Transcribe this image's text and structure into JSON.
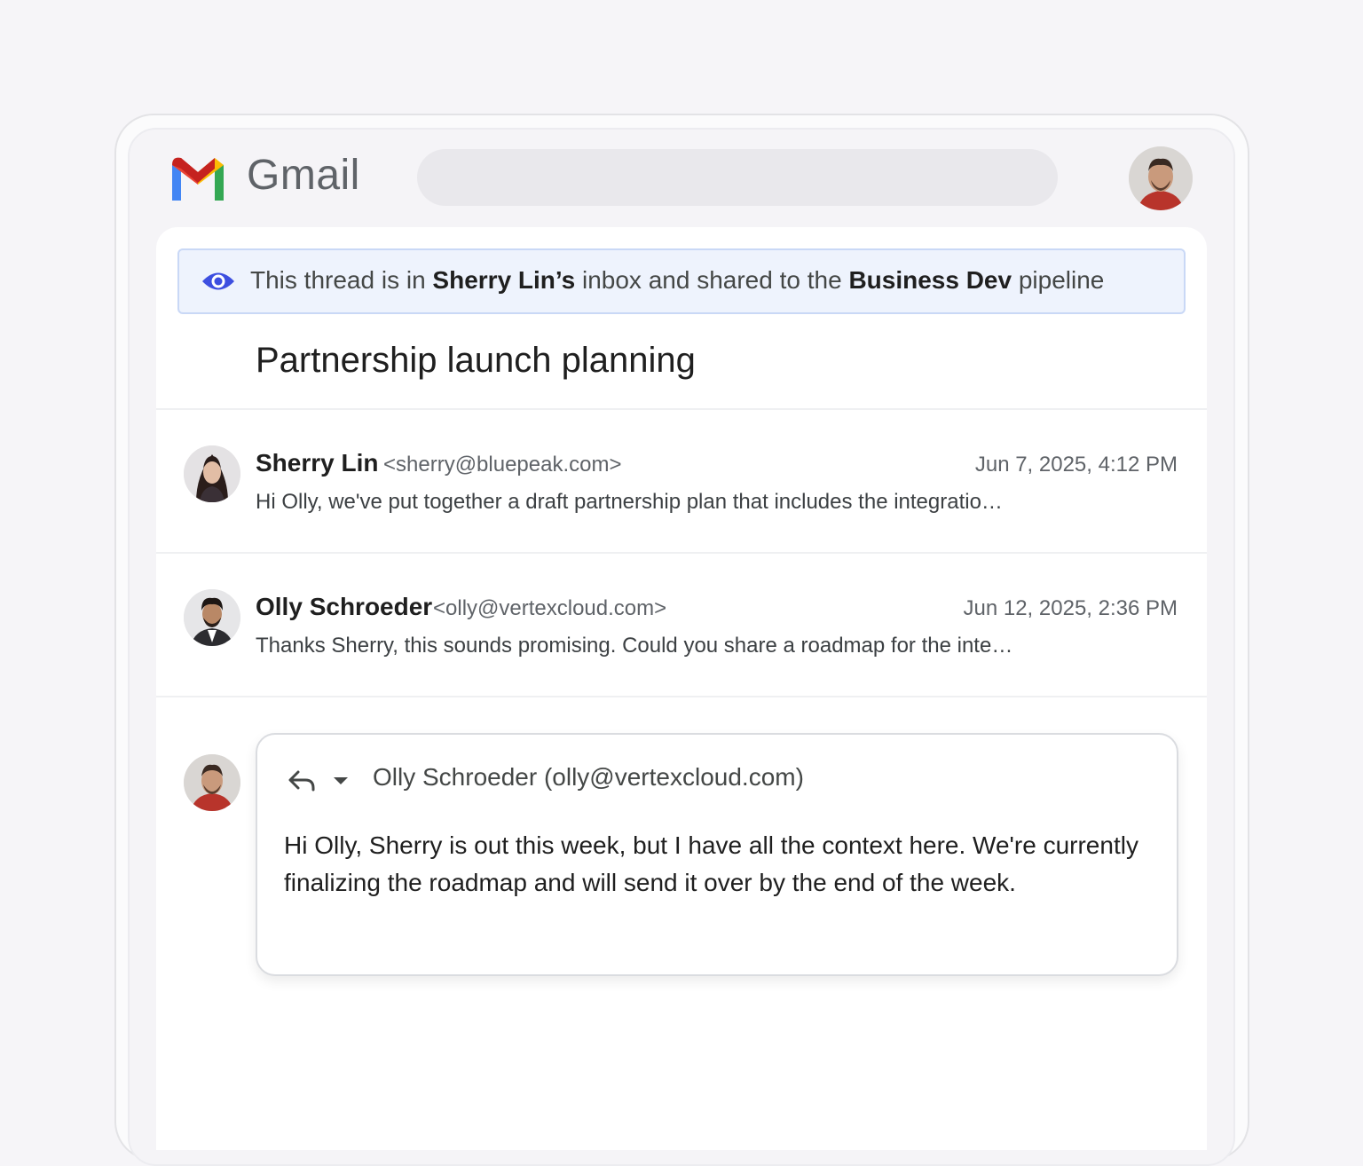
{
  "app": {
    "name": "Gmail",
    "search_placeholder": ""
  },
  "banner": {
    "part1": "This thread is in ",
    "owner": "Sherry Lin’s",
    "part2": " inbox and shared to the ",
    "pipeline": "Business Dev",
    "part3": " pipeline",
    "accent_color": "#3d4fe0"
  },
  "thread": {
    "title": "Partnership launch planning",
    "messages": [
      {
        "sender": "Sherry Lin",
        "email": "<sherry@bluepeak.com>",
        "date": "Jun 7, 2025, 4:12 PM",
        "snippet": "Hi Olly, we've put together a draft partnership plan that includes the integratio…"
      },
      {
        "sender": "Olly Schroeder",
        "email": "<olly@vertexcloud.com>",
        "date": "Jun 12, 2025, 2:36 PM",
        "snippet": "Thanks Sherry, this sounds promising. Could you share a roadmap for the inte…"
      }
    ]
  },
  "reply": {
    "to": "Olly Schroeder (olly@vertexcloud.com)",
    "body": "Hi Olly, Sherry is out this week, but I have all the context here. We're currently finalizing the roadmap and will send it over by the end of the week."
  }
}
